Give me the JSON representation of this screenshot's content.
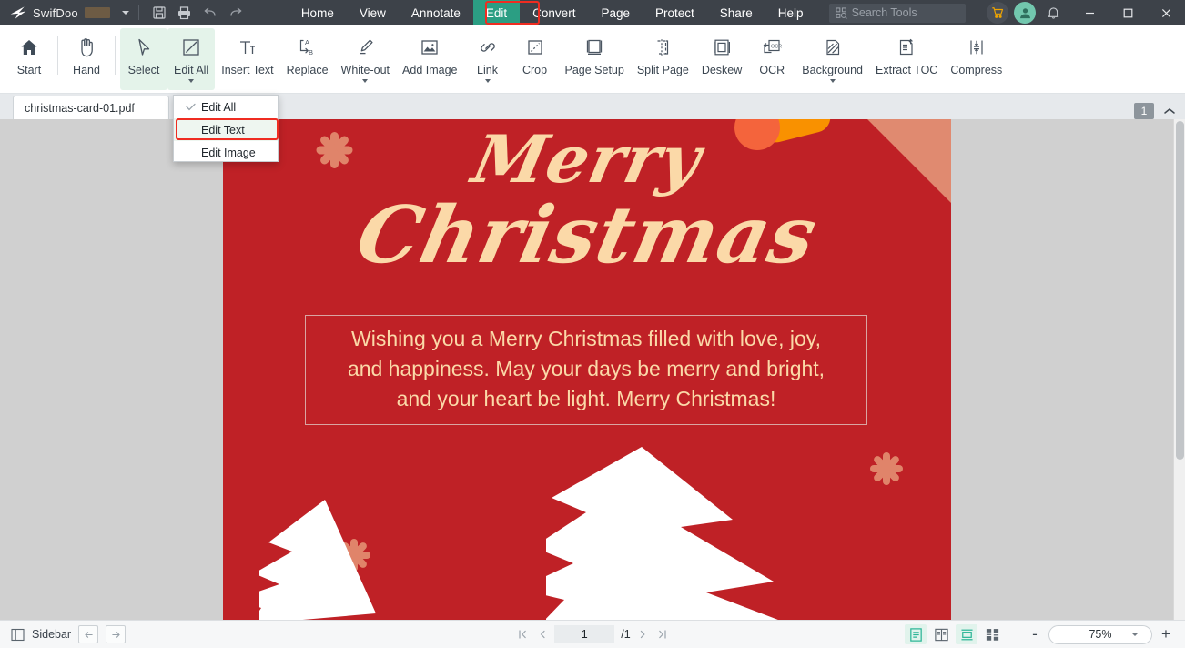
{
  "titlebar": {
    "brand": "SwifDoo",
    "quick_actions": [
      {
        "name": "save-icon",
        "label": "Save"
      },
      {
        "name": "print-icon",
        "label": "Print"
      },
      {
        "name": "undo-icon",
        "label": "Undo"
      },
      {
        "name": "redo-icon",
        "label": "Redo"
      }
    ],
    "menus": [
      {
        "label": "Home",
        "active": false
      },
      {
        "label": "View",
        "active": false
      },
      {
        "label": "Annotate",
        "active": false
      },
      {
        "label": "Edit",
        "active": true
      },
      {
        "label": "Convert",
        "active": false
      },
      {
        "label": "Page",
        "active": false
      },
      {
        "label": "Protect",
        "active": false
      },
      {
        "label": "Share",
        "active": false
      },
      {
        "label": "Help",
        "active": false
      }
    ],
    "search_placeholder": "Search Tools",
    "window_controls": [
      "minimize",
      "maximize",
      "close"
    ],
    "accent_active": "#2b9e83",
    "highlight_red": "#ef2c21"
  },
  "ribbon": {
    "buttons": [
      {
        "label": "Start",
        "icon": "home-icon",
        "selected": false,
        "caret": false
      },
      {
        "label": "Hand",
        "icon": "hand-icon",
        "selected": false,
        "caret": false
      },
      {
        "label": "Select",
        "icon": "cursor-icon",
        "selected": true,
        "caret": false
      },
      {
        "label": "Edit All",
        "icon": "edit-all-icon",
        "selected": true,
        "caret": true
      },
      {
        "label": "Insert Text",
        "icon": "insert-text-icon",
        "selected": false,
        "caret": false
      },
      {
        "label": "Replace",
        "icon": "replace-icon",
        "selected": false,
        "caret": false
      },
      {
        "label": "White-out",
        "icon": "whiteout-icon",
        "selected": false,
        "caret": true
      },
      {
        "label": "Add Image",
        "icon": "add-image-icon",
        "selected": false,
        "caret": false
      },
      {
        "label": "Link",
        "icon": "link-icon",
        "selected": false,
        "caret": true
      },
      {
        "label": "Crop",
        "icon": "crop-icon",
        "selected": false,
        "caret": false
      },
      {
        "label": "Page Setup",
        "icon": "page-setup-icon",
        "selected": false,
        "caret": false
      },
      {
        "label": "Split Page",
        "icon": "split-page-icon",
        "selected": false,
        "caret": false
      },
      {
        "label": "Deskew",
        "icon": "deskew-icon",
        "selected": false,
        "caret": false
      },
      {
        "label": "OCR",
        "icon": "ocr-icon",
        "selected": false,
        "caret": false
      },
      {
        "label": "Background",
        "icon": "background-icon",
        "selected": false,
        "caret": true
      },
      {
        "label": "Extract TOC",
        "icon": "extract-toc-icon",
        "selected": false,
        "caret": false
      },
      {
        "label": "Compress",
        "icon": "compress-icon",
        "selected": false,
        "caret": false
      }
    ]
  },
  "dropdown": {
    "items": [
      {
        "label": "Edit All",
        "checked": true,
        "highlighted": false
      },
      {
        "label": "Edit Text",
        "checked": false,
        "highlighted": true
      },
      {
        "label": "Edit Image",
        "checked": false,
        "highlighted": false
      }
    ]
  },
  "tabstrip": {
    "document_tab": "christmas-card-01.pdf",
    "page_badge": "1"
  },
  "document": {
    "title_line1": "Merry",
    "title_line2": "Christmas",
    "body_line1": "Wishing you a Merry Christmas filled with love, joy,",
    "body_line2": "and happiness. May your days be merry and bright,",
    "body_line3": "and your heart be light. Merry Christmas!",
    "background_color": "#bf2126",
    "text_color": "#fbd9a8",
    "accent_orange": "#f99100",
    "accent_salmon": "#e0846a"
  },
  "statusbar": {
    "sidebar_label": "Sidebar",
    "prev_label": "Previous",
    "next_label": "Next",
    "page_current": "1",
    "page_total": "/1",
    "view_modes": [
      {
        "name": "single-page-view",
        "on": true
      },
      {
        "name": "two-page-view",
        "on": false
      },
      {
        "name": "continuous-scroll-view",
        "on": true
      },
      {
        "name": "thumbnail-grid-view",
        "on": false
      }
    ],
    "zoom_value": "75%",
    "zoom_out": "-",
    "zoom_in": "+"
  }
}
